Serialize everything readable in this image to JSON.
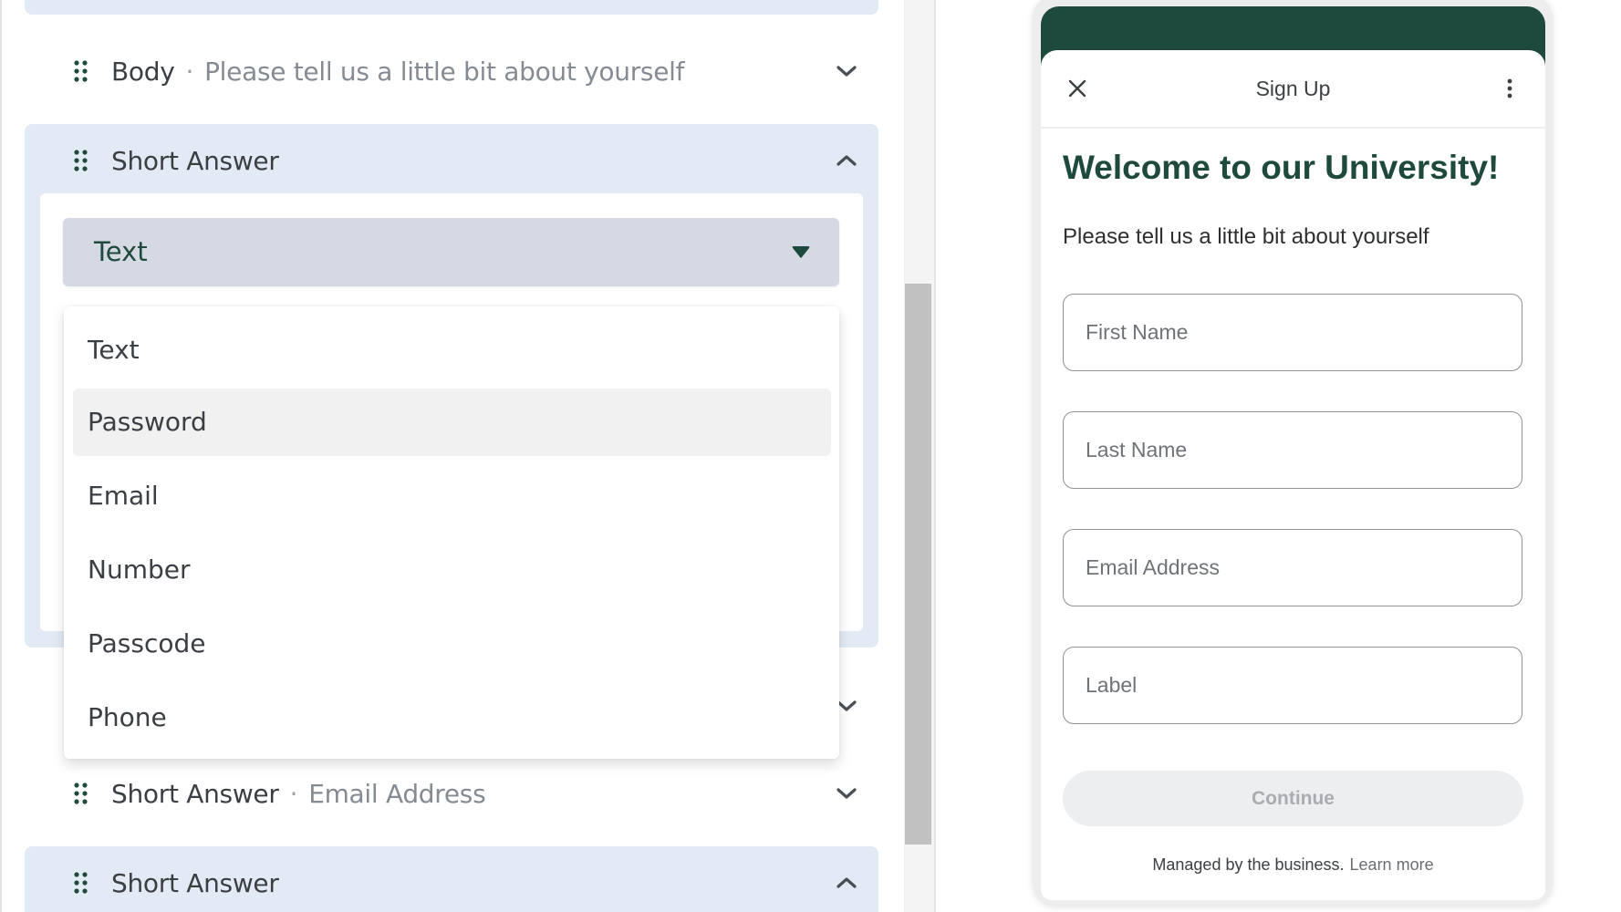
{
  "editor": {
    "rows": [
      {
        "type": "Body",
        "subtitle": "Please tell us a little bit about yourself",
        "expanded": false
      },
      {
        "type": "Short Answer",
        "subtitle": "",
        "expanded": true
      },
      {
        "type": "Short Answer",
        "subtitle": "",
        "expanded": false
      },
      {
        "type": "Short Answer",
        "subtitle": "Email Address",
        "expanded": false
      },
      {
        "type": "Short Answer",
        "subtitle": "",
        "expanded": true
      }
    ],
    "separator": "·",
    "field_type_select": {
      "value": "Text",
      "options": [
        "Text",
        "Password",
        "Email",
        "Number",
        "Passcode",
        "Phone"
      ],
      "highlighted": "Password"
    }
  },
  "preview": {
    "header_title": "Sign Up",
    "heading": "Welcome to our University!",
    "subheading": "Please tell us a little bit about yourself",
    "inputs": [
      {
        "placeholder": "First Name",
        "value": ""
      },
      {
        "placeholder": "Last Name",
        "value": ""
      },
      {
        "placeholder": "Email Address",
        "value": ""
      },
      {
        "placeholder": "Label",
        "value": ""
      }
    ],
    "continue_label": "Continue",
    "footer_text": "Managed by the business.",
    "footer_link": "Learn more"
  },
  "colors": {
    "brand_green": "#1e4a3d",
    "card_blue": "#e2ebf5",
    "select_bg": "#d5d9e4"
  },
  "icons": {
    "drag": "drag-handle-icon",
    "expand": "chevron-down-icon",
    "collapse": "chevron-up-icon",
    "select_caret": "caret-down-icon",
    "close": "close-icon",
    "more": "more-vertical-icon"
  }
}
